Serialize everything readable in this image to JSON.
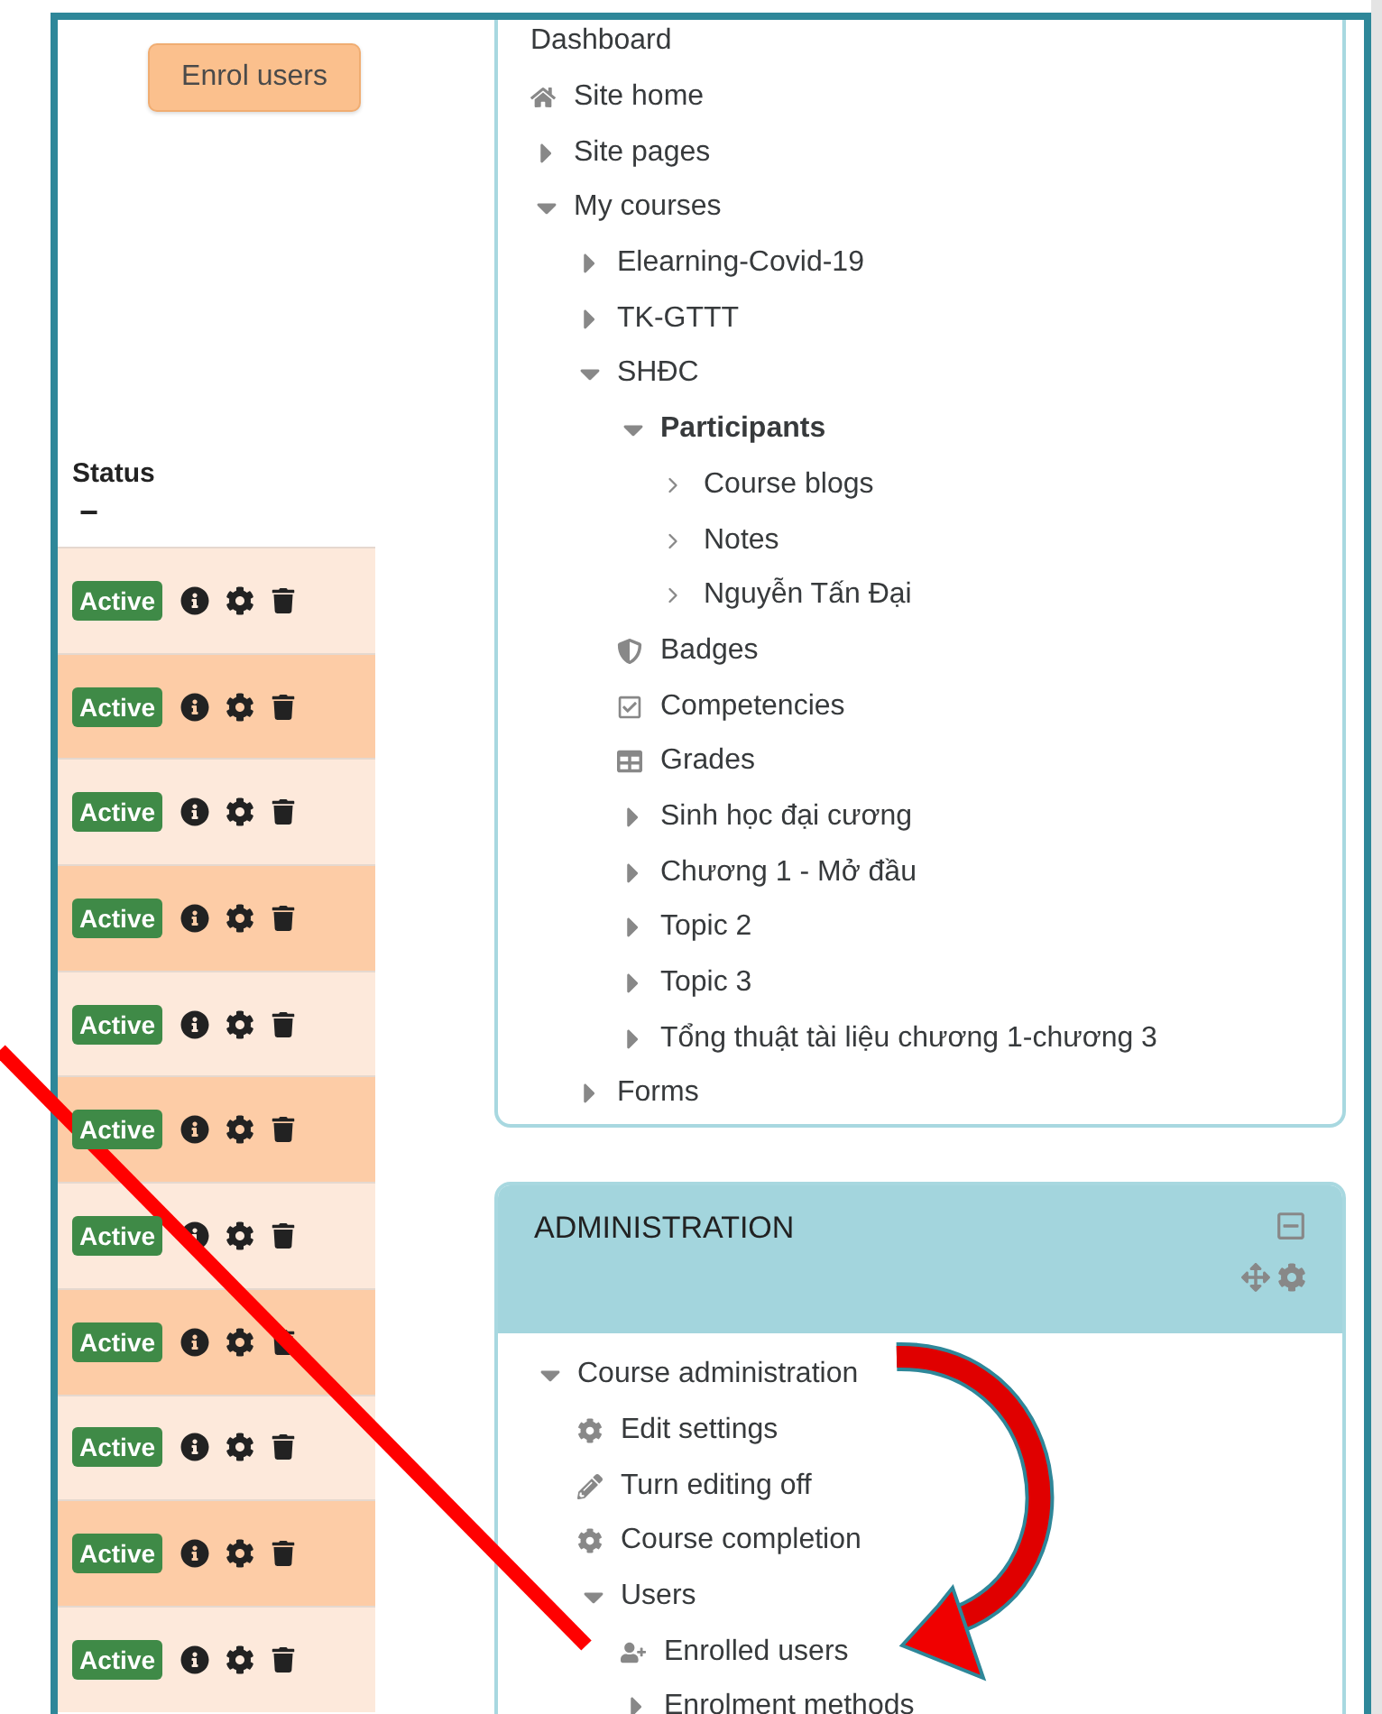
{
  "enrol_button": {
    "label": "Enrol users"
  },
  "status_column": {
    "heading": "Status",
    "sort_mark": "−",
    "rows": [
      {
        "status": "Active"
      },
      {
        "status": "Active"
      },
      {
        "status": "Active"
      },
      {
        "status": "Active"
      },
      {
        "status": "Active"
      },
      {
        "status": "Active"
      },
      {
        "status": "Active"
      },
      {
        "status": "Active"
      },
      {
        "status": "Active"
      },
      {
        "status": "Active"
      },
      {
        "status": "Active"
      }
    ]
  },
  "navigation": [
    {
      "label": "Dashboard",
      "kind": "text",
      "current": false
    },
    {
      "label": "Site home",
      "kind": "home",
      "current": false
    },
    {
      "label": "Site pages",
      "kind": "branch",
      "expanded": false,
      "current": false
    },
    {
      "label": "My courses",
      "kind": "branch",
      "expanded": true,
      "current": false,
      "children": [
        {
          "label": "Elearning-Covid-19",
          "kind": "branch",
          "expanded": false,
          "current": false
        },
        {
          "label": "TK-GTTT",
          "kind": "branch",
          "expanded": false,
          "current": false
        },
        {
          "label": "SHĐC",
          "kind": "branch",
          "expanded": true,
          "current": false,
          "children": [
            {
              "label": "Participants",
              "kind": "branch",
              "expanded": true,
              "current": true,
              "children": [
                {
                  "label": "Course blogs",
                  "kind": "chevron",
                  "current": false
                },
                {
                  "label": "Notes",
                  "kind": "chevron",
                  "current": false
                },
                {
                  "label": "Nguyễn Tấn Đại",
                  "kind": "chevron",
                  "current": false
                }
              ]
            },
            {
              "label": "Badges",
              "kind": "badge",
              "current": false
            },
            {
              "label": "Competencies",
              "kind": "competency",
              "current": false
            },
            {
              "label": "Grades",
              "kind": "grades",
              "current": false
            },
            {
              "label": "Sinh học đại cương",
              "kind": "branch",
              "expanded": false,
              "current": false
            },
            {
              "label": "Chương 1 - Mở đầu",
              "kind": "branch",
              "expanded": false,
              "current": false
            },
            {
              "label": "Topic 2",
              "kind": "branch",
              "expanded": false,
              "current": false
            },
            {
              "label": "Topic 3",
              "kind": "branch",
              "expanded": false,
              "current": false
            },
            {
              "label": "Tổng thuật tài liệu chương 1-chương 3",
              "kind": "branch",
              "expanded": false,
              "current": false
            }
          ]
        },
        {
          "label": "Forms",
          "kind": "branch",
          "expanded": false,
          "current": false
        }
      ]
    }
  ],
  "administration": {
    "title": "ADMINISTRATION",
    "items": [
      {
        "label": "Course administration",
        "kind": "branch",
        "expanded": true,
        "current": false,
        "children": [
          {
            "label": "Edit settings",
            "kind": "gear",
            "current": false
          },
          {
            "label": "Turn editing off",
            "kind": "pencil",
            "current": false
          },
          {
            "label": "Course completion",
            "kind": "gear",
            "current": false
          },
          {
            "label": "Users",
            "kind": "branch",
            "expanded": true,
            "current": false,
            "children": [
              {
                "label": "Enrolled users",
                "kind": "user-add",
                "current": false
              },
              {
                "label": "Enrolment methods",
                "kind": "branch",
                "expanded": false,
                "current": false
              }
            ]
          }
        ]
      }
    ]
  }
}
